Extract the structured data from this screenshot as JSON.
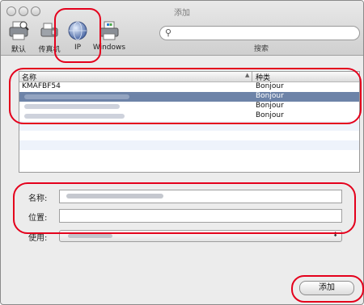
{
  "window": {
    "title": "添加"
  },
  "toolbar": {
    "tools": [
      {
        "label": "默认",
        "icon": "default-printer-icon"
      },
      {
        "label": "传真机",
        "icon": "fax-icon"
      },
      {
        "label": "IP",
        "icon": "ip-globe-icon"
      },
      {
        "label": "Windows",
        "icon": "windows-printer-icon"
      }
    ],
    "search": {
      "placeholder": "",
      "caption": "搜索"
    }
  },
  "list": {
    "columns": {
      "name": "名称",
      "kind": "种类"
    },
    "rows": [
      {
        "name": "KMAFBF54",
        "kind": "Bonjour",
        "selected": false
      },
      {
        "name": "",
        "kind": "Bonjour",
        "selected": true
      },
      {
        "name": "",
        "kind": "Bonjour",
        "selected": false
      },
      {
        "name": "",
        "kind": "Bonjour",
        "selected": false
      }
    ]
  },
  "form": {
    "name_label": "名称:",
    "location_label": "位置:",
    "location_value": "",
    "use_label": "使用:"
  },
  "buttons": {
    "add": "添加"
  },
  "colors": {
    "highlight_circle": "#e4001c",
    "selection": "#6d83a8"
  }
}
